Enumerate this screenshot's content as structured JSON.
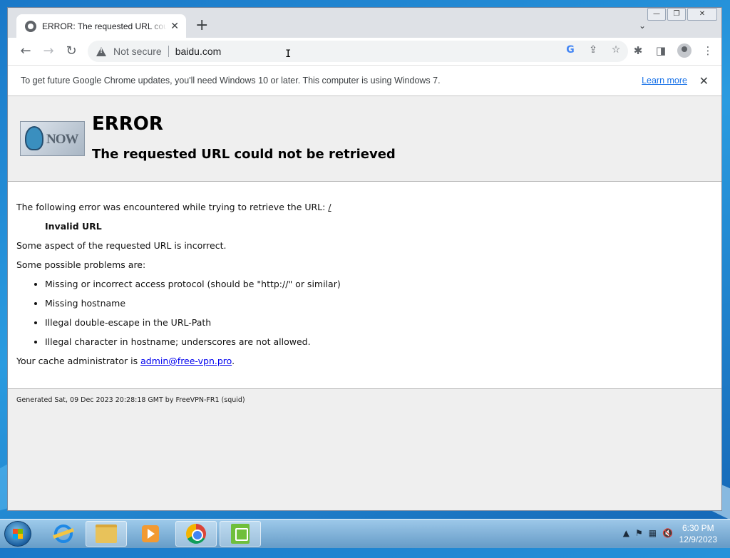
{
  "browser": {
    "tab": {
      "title": "ERROR: The requested URL could not be retrieved",
      "close": "✕"
    },
    "new_tab": "+",
    "tab_search": "⌄",
    "window_controls": {
      "minimize": "—",
      "restore": "❐",
      "close": "✕"
    },
    "nav": {
      "back": "←",
      "forward": "→",
      "reload": "↻"
    },
    "omnibox": {
      "security_label": "Not secure",
      "url": "baidu.com"
    },
    "omnibox_icons": [
      "google-lens-icon",
      "share-icon",
      "bookmark-star-icon"
    ],
    "toolbar_icons": [
      "extensions-puzzle-icon",
      "side-panel-icon",
      "profile-avatar-icon",
      "kebab-menu-icon"
    ]
  },
  "infobar": {
    "message": "To get future Google Chrome updates, you'll need Windows 10 or later. This computer is using Windows 7.",
    "learn_more": "Learn more",
    "close": "✕"
  },
  "page": {
    "logo_text": "NOW",
    "title": "ERROR",
    "subtitle": "The requested URL could not be retrieved",
    "intro": "The following error was encountered while trying to retrieve the URL: ",
    "intro_url": "/",
    "error_name": "Invalid URL",
    "aspect": "Some aspect of the requested URL is incorrect.",
    "problems_heading": "Some possible problems are:",
    "problems": [
      "Missing or incorrect access protocol (should be \"http://\" or similar)",
      "Missing hostname",
      "Illegal double-escape in the URL-Path",
      "Illegal character in hostname; underscores are not allowed."
    ],
    "admin_prefix": "Your cache administrator is ",
    "admin_email": "admin@free-vpn.pro",
    "admin_suffix": ".",
    "footer": "Generated Sat, 09 Dec 2023 20:28:18 GMT by FreeVPN-FR1 (squid)"
  },
  "taskbar": {
    "apps": [
      "internet-explorer",
      "file-explorer",
      "media-player",
      "google-chrome",
      "notepad-plus-plus"
    ],
    "tray_icons": [
      "show-hidden-icons",
      "action-center-flag",
      "network",
      "volume-muted"
    ],
    "tray_show": "▲",
    "clock": {
      "time": "6:30 PM",
      "date": "12/9/2023"
    }
  },
  "colors": {
    "link": "#1a73e8",
    "admin_link": "#0000ee",
    "header_bg": "#efefef"
  }
}
